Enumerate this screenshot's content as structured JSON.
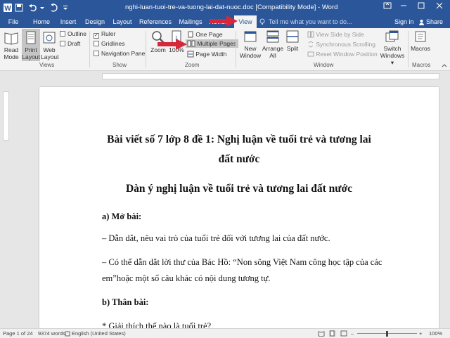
{
  "window": {
    "title": "nghi-luan-tuoi-tre-va-tuong-lai-dat-nuoc.doc [Compatibility Mode] - Word",
    "controls": [
      "restore",
      "minimize",
      "maximize",
      "close"
    ]
  },
  "tabs": [
    "File",
    "Home",
    "Insert",
    "Design",
    "Layout",
    "References",
    "Mailings",
    "Review",
    "View"
  ],
  "active_tab": "View",
  "tell_me_placeholder": "Tell me what you want to do...",
  "sign_in": "Sign in",
  "share": "Share",
  "ribbon": {
    "views": {
      "read_mode": "Read Mode",
      "print_layout_1": "Print",
      "print_layout_2": "Layout",
      "web_layout_1": "Web",
      "web_layout_2": "Layout",
      "outline": "Outline",
      "draft": "Draft",
      "group": "Views"
    },
    "show": {
      "ruler": "Ruler",
      "gridlines": "Gridlines",
      "navigation_pane": "Navigation Pane",
      "group": "Show"
    },
    "zoom": {
      "zoom": "Zoom",
      "hundred": "100%",
      "one_page": "One Page",
      "multiple_pages": "Multiple Pages",
      "page_width": "Page Width",
      "group": "Zoom"
    },
    "window": {
      "new_window_1": "New",
      "new_window_2": "Window",
      "arrange_all_1": "Arrange",
      "arrange_all_2": "All",
      "split": "Split",
      "side_by_side": "View Side by Side",
      "sync_scroll": "Synchronous Scrolling",
      "reset_position": "Reset Window Position",
      "switch_1": "Switch",
      "switch_2": "Windows ▾",
      "group": "Window"
    },
    "macros": {
      "label": "Macros",
      "group": "Macros"
    }
  },
  "document": {
    "title_line1": "Bài viết số 7 lớp 8 đề 1: Nghị luận về tuổi trẻ và tương lai",
    "title_line2": "đất nước",
    "heading2": "Dàn ý nghị luận về tuổi trẻ và tương lai đất nước",
    "section_a": "a) Mở bài:",
    "p1": "– Dẫn dắt, nêu vai trò của tuổi trẻ đối với tương lai của đất nước.",
    "p2_line1": "– Có thể dẫn dắt lời thư của Bác Hồ: “Non sông Việt Nam công học tập của các",
    "p2_line2": "em”hoặc một số câu khác có nội dung tương tự.",
    "section_b": "b) Thân bài:",
    "p3": "* Giải thích thế nào là tuổi trẻ?"
  },
  "status": {
    "page": "Page 1 of 24",
    "words": "9374 words",
    "language": "English (United States)",
    "zoom": "100%"
  }
}
